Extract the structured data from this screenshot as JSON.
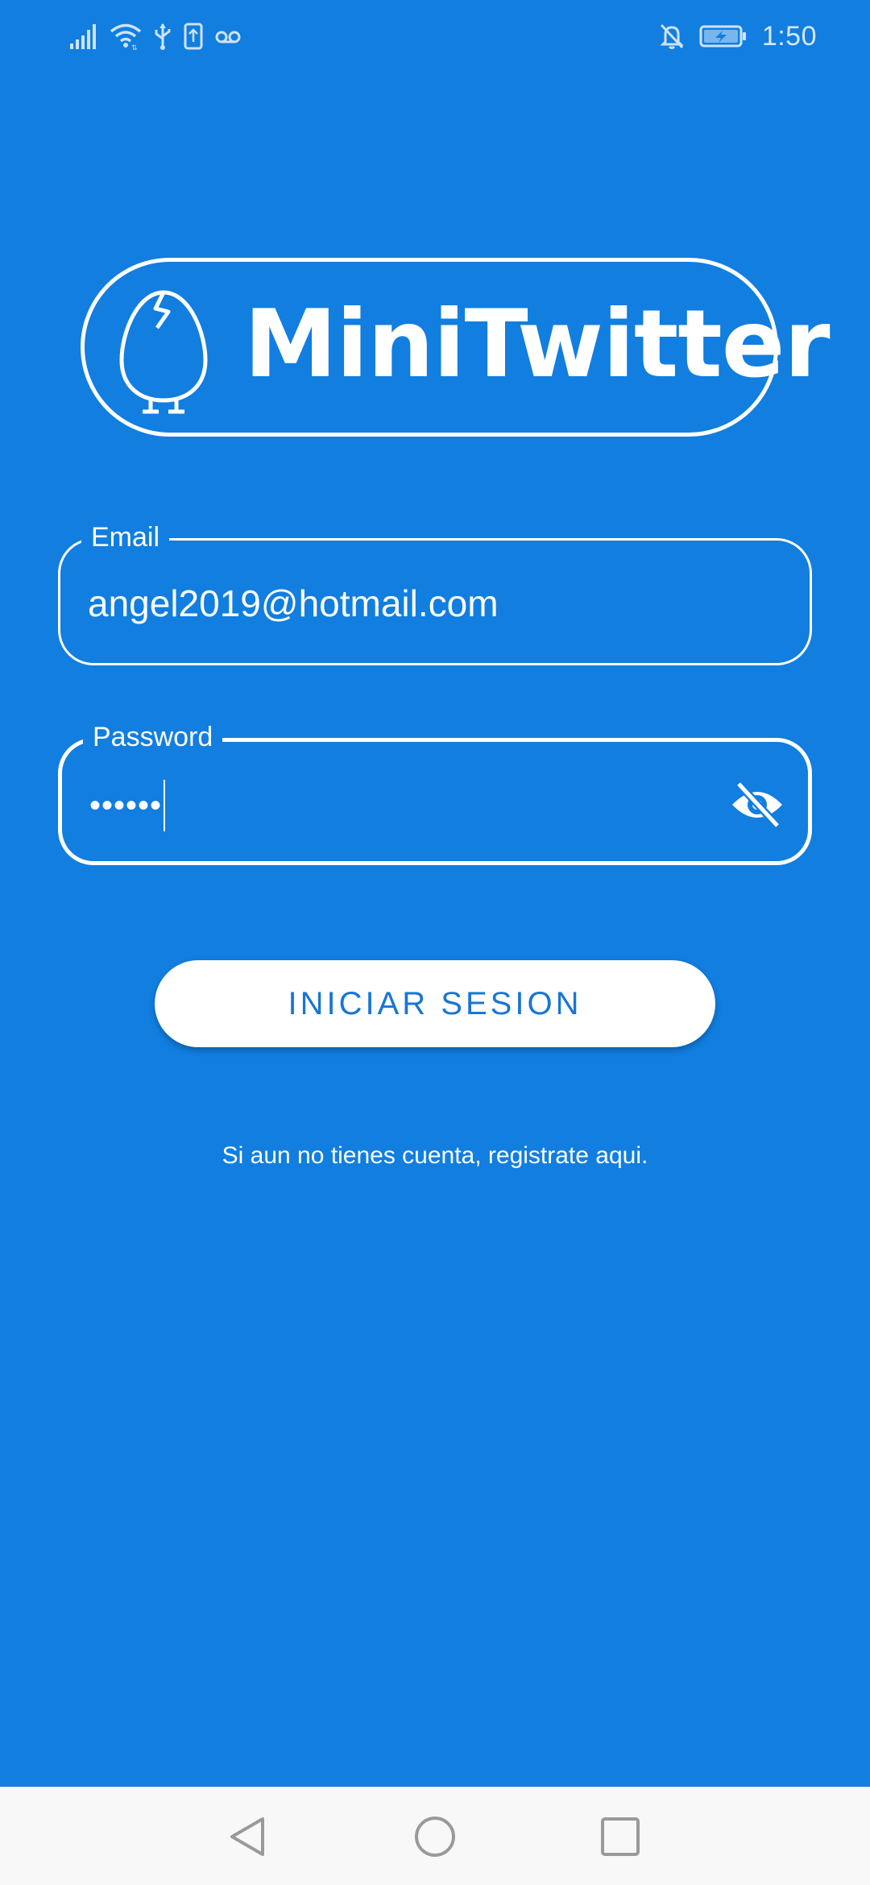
{
  "status_bar": {
    "time": "1:50",
    "icons_left": [
      "signal-icon",
      "wifi-icon",
      "usb-icon",
      "sim-upload-icon",
      "voicemail-icon"
    ],
    "icons_right": [
      "notifications-off-icon",
      "battery-charging-icon"
    ]
  },
  "logo": {
    "text": "MiniTwitter",
    "icon": "egg-mascot-icon"
  },
  "email_field": {
    "label": "Email",
    "value": "angel2019@hotmail.com"
  },
  "password_field": {
    "label": "Password",
    "masked_value": "••••••",
    "toggle_icon": "visibility-off-icon"
  },
  "login_button": {
    "label": "INICIAR SESION"
  },
  "register_link": {
    "text": "Si aun no tienes cuenta, registrate aqui."
  },
  "nav_bar": {
    "buttons": [
      "back-icon",
      "home-icon",
      "recents-icon"
    ]
  },
  "colors": {
    "background": "#117EE0",
    "accent": "#1976D2",
    "foreground": "#FFFFFF"
  }
}
